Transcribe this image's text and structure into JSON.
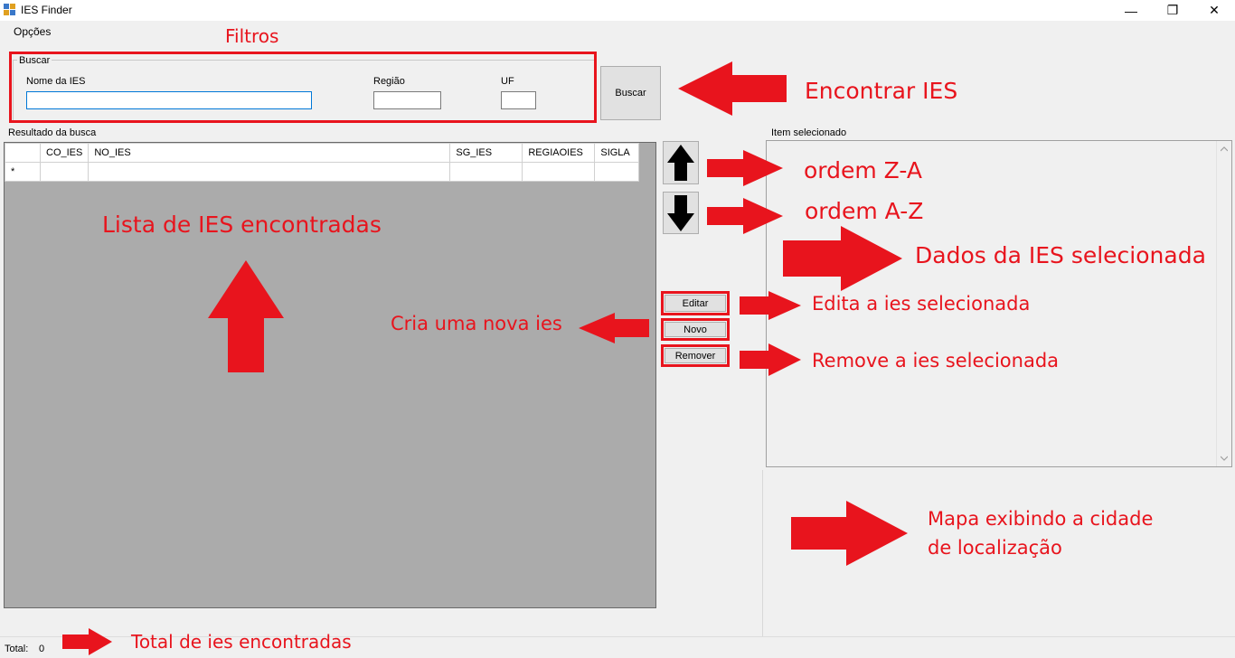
{
  "window": {
    "title": "IES Finder",
    "minimize": "—",
    "restore": "❐",
    "close": "✕"
  },
  "menu": {
    "options": "Opções"
  },
  "search": {
    "group_label": "Buscar",
    "name_label": "Nome da IES",
    "name_value": "",
    "region_label": "Região",
    "region_value": "",
    "uf_label": "UF",
    "uf_value": "",
    "button": "Buscar"
  },
  "results": {
    "group_label": "Resultado da busca",
    "columns": [
      "CO_IES",
      "NO_IES",
      "SG_IES",
      "REGIAOIES",
      "SIGLA"
    ],
    "new_row_marker": "*"
  },
  "actions": {
    "edit": "Editar",
    "new": "Novo",
    "remove": "Remover"
  },
  "selected": {
    "group_label": "Item selecionado"
  },
  "status": {
    "total_label": "Total:",
    "total_value": "0"
  },
  "annotations": {
    "filters": "Filtros",
    "find": "Encontrar IES",
    "order_za": "ordem Z-A",
    "order_az": "ordem A-Z",
    "selected_data": "Dados da IES selecionada",
    "list": "Lista de IES encontradas",
    "edit": "Edita a ies selecionada",
    "create": "Cria uma nova ies",
    "remove": "Remove a ies selecionada",
    "map_line1": "Mapa exibindo a cidade",
    "map_line2": "de localização",
    "total": "Total de ies encontradas"
  },
  "colors": {
    "annotation": "#e8141d",
    "grid_bg": "#ababab",
    "window_bg": "#f0f0f0",
    "focus": "#0078d7"
  }
}
